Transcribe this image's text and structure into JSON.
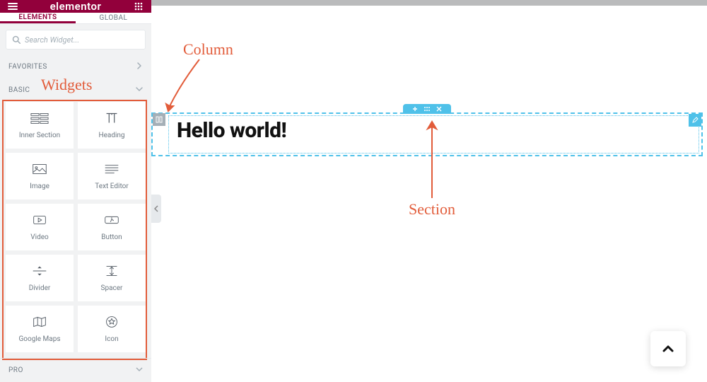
{
  "header": {
    "logo": "elementor"
  },
  "tabs": {
    "elements": "ELEMENTS",
    "global": "GLOBAL"
  },
  "search": {
    "placeholder": "Search Widget..."
  },
  "categories": {
    "favorites": "FAVORITES",
    "basic": "BASIC",
    "pro": "PRO"
  },
  "widgets": [
    {
      "name": "inner-section",
      "label": "Inner Section"
    },
    {
      "name": "heading",
      "label": "Heading"
    },
    {
      "name": "image",
      "label": "Image"
    },
    {
      "name": "text-editor",
      "label": "Text Editor"
    },
    {
      "name": "video",
      "label": "Video"
    },
    {
      "name": "button",
      "label": "Button"
    },
    {
      "name": "divider",
      "label": "Divider"
    },
    {
      "name": "spacer",
      "label": "Spacer"
    },
    {
      "name": "google-maps",
      "label": "Google Maps"
    },
    {
      "name": "icon",
      "label": "Icon"
    }
  ],
  "canvas": {
    "heading": "Hello world!"
  },
  "annotations": {
    "widgets": "Widgets",
    "column": "Column",
    "section": "Section"
  }
}
